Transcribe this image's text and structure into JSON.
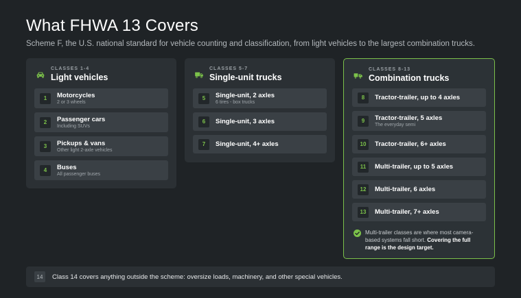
{
  "header": {
    "title": "What FHWA 13 Covers",
    "subtitle": "Scheme F, the U.S. national standard for vehicle counting and classification, from light vehicles to the largest combination trucks."
  },
  "colors": {
    "accent": "#7cc24a",
    "background": "#1f2326",
    "card": "#2b3034",
    "row": "#3a4045"
  },
  "groups": [
    {
      "eyebrow": "CLASSES 1-4",
      "title": "Light vehicles",
      "icon": "car-icon",
      "items": [
        {
          "num": "1",
          "label": "Motorcycles",
          "sub": "2 or 3 wheels"
        },
        {
          "num": "2",
          "label": "Passenger cars",
          "sub": "Including SUVs"
        },
        {
          "num": "3",
          "label": "Pickups & vans",
          "sub": "Other light 2-axle vehicles"
        },
        {
          "num": "4",
          "label": "Buses",
          "sub": "All passenger buses"
        }
      ]
    },
    {
      "eyebrow": "CLASSES 5-7",
      "title": "Single-unit trucks",
      "icon": "truck-icon",
      "items": [
        {
          "num": "5",
          "label": "Single-unit, 2 axles",
          "sub": "6 tires - box trucks"
        },
        {
          "num": "6",
          "label": "Single-unit, 3 axles",
          "sub": ""
        },
        {
          "num": "7",
          "label": "Single-unit, 4+ axles",
          "sub": ""
        }
      ]
    },
    {
      "eyebrow": "CLASSES 8-13",
      "title": "Combination trucks",
      "icon": "combination-truck-icon",
      "items": [
        {
          "num": "8",
          "label": "Tractor-trailer, up to 4 axles",
          "sub": ""
        },
        {
          "num": "9",
          "label": "Tractor-trailer, 5 axles",
          "sub": "The everyday semi"
        },
        {
          "num": "10",
          "label": "Tractor-trailer, 6+ axles",
          "sub": ""
        },
        {
          "num": "11",
          "label": "Multi-trailer, up to 5 axles",
          "sub": ""
        },
        {
          "num": "12",
          "label": "Multi-trailer, 6 axles",
          "sub": ""
        },
        {
          "num": "13",
          "label": "Multi-trailer, 7+ axles",
          "sub": ""
        }
      ],
      "note_text": "Multi-trailer classes are where most camera-based systems fall short. ",
      "note_strong": "Covering the full range is the design target."
    }
  ],
  "footer": {
    "num": "14",
    "text": "Class 14 covers anything outside the scheme: oversize loads, machinery, and other special vehicles."
  }
}
